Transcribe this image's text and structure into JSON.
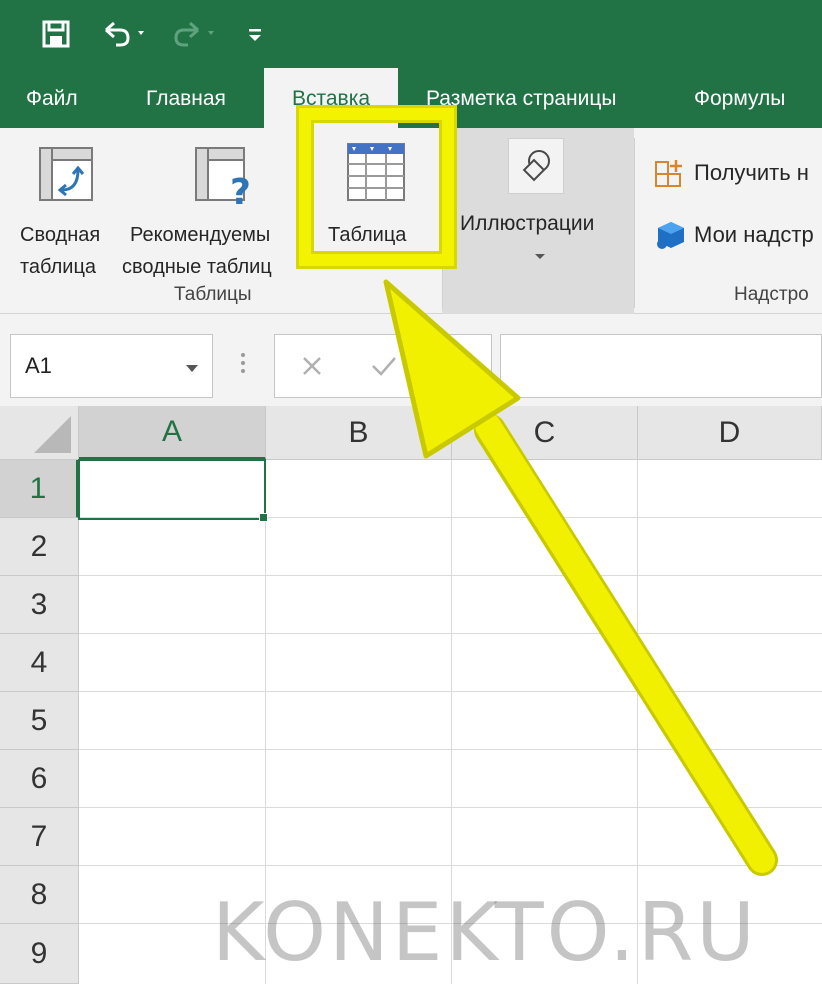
{
  "quick_access": {
    "save_icon": "save-icon",
    "undo_icon": "undo-icon",
    "redo_icon": "redo-icon",
    "customize_icon": "customize-qat-icon"
  },
  "tabs": [
    {
      "label": "Файл"
    },
    {
      "label": "Главная"
    },
    {
      "label": "Вставка"
    },
    {
      "label": "Разметка страницы"
    },
    {
      "label": "Формулы"
    }
  ],
  "ribbon": {
    "pivot_line1": "Сводная",
    "pivot_line2": "таблица",
    "recommended_line1": "Рекомендуемы",
    "recommended_line2": "сводные таблиц",
    "table_label": "Таблица",
    "tables_group": "Таблицы",
    "illustrations_label": "Иллюстрации",
    "get_addins": "Получить н",
    "my_addins": "Мои надстр",
    "addins_group": "Надстро"
  },
  "formula_bar": {
    "name_box": "A1",
    "formula_value": ""
  },
  "columns": [
    "A",
    "B",
    "C",
    "D"
  ],
  "rows": [
    "1",
    "2",
    "3",
    "4",
    "5",
    "6",
    "7",
    "8",
    "9"
  ],
  "watermark": "KONEKTO.RU",
  "colors": {
    "excel_green": "#217346",
    "highlight_yellow": "#f0f000",
    "highlight_border": "#d8d800"
  }
}
